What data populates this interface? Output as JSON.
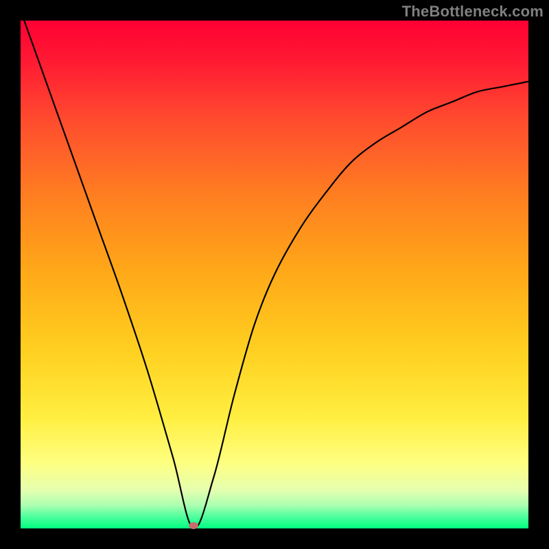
{
  "watermark": "TheBottleneck.com",
  "chart_data": {
    "type": "line",
    "title": "",
    "xlabel": "",
    "ylabel": "",
    "xlim": [
      0,
      1
    ],
    "ylim": [
      0,
      1
    ],
    "series": [
      {
        "name": "bottleneck-curve",
        "x": [
          0.0,
          0.05,
          0.1,
          0.15,
          0.2,
          0.25,
          0.3,
          0.34,
          0.38,
          0.42,
          0.46,
          0.5,
          0.55,
          0.6,
          0.65,
          0.7,
          0.75,
          0.8,
          0.85,
          0.9,
          0.95,
          1.0
        ],
        "y": [
          1.02,
          0.88,
          0.74,
          0.6,
          0.46,
          0.31,
          0.14,
          0.0,
          0.1,
          0.26,
          0.4,
          0.5,
          0.59,
          0.66,
          0.72,
          0.76,
          0.79,
          0.82,
          0.84,
          0.86,
          0.87,
          0.88
        ]
      }
    ],
    "annotations": [
      {
        "name": "minimum-dot",
        "x": 0.34,
        "y": 0.005
      }
    ],
    "background_gradient": {
      "stops": [
        {
          "pos": 0.0,
          "color": "#ff0033"
        },
        {
          "pos": 0.5,
          "color": "#ffaa18"
        },
        {
          "pos": 0.87,
          "color": "#ffff80"
        },
        {
          "pos": 1.0,
          "color": "#00ff80"
        }
      ]
    }
  }
}
